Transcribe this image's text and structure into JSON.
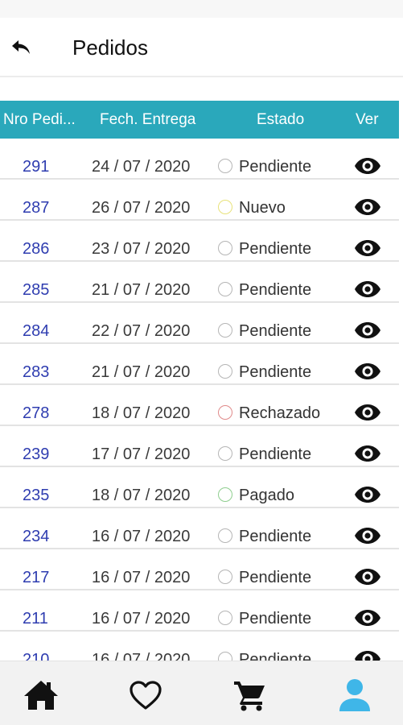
{
  "header": {
    "title": "Pedidos"
  },
  "table": {
    "columns": {
      "nro": "Nro Pedi...",
      "fecha": "Fech. Entrega",
      "estado": "Estado",
      "ver": "Ver"
    },
    "rows": [
      {
        "nro": "291",
        "fecha": "24 / 07 / 2020",
        "estado": "Pendiente",
        "status_color": "#b5b5b5"
      },
      {
        "nro": "287",
        "fecha": "26 / 07 / 2020",
        "estado": "Nuevo",
        "status_color": "#e8e27a"
      },
      {
        "nro": "286",
        "fecha": "23 / 07 / 2020",
        "estado": "Pendiente",
        "status_color": "#b5b5b5"
      },
      {
        "nro": "285",
        "fecha": "21 / 07 / 2020",
        "estado": "Pendiente",
        "status_color": "#b5b5b5"
      },
      {
        "nro": "284",
        "fecha": "22 / 07 / 2020",
        "estado": "Pendiente",
        "status_color": "#b5b5b5"
      },
      {
        "nro": "283",
        "fecha": "21 / 07 / 2020",
        "estado": "Pendiente",
        "status_color": "#b5b5b5"
      },
      {
        "nro": "278",
        "fecha": "18 / 07 / 2020",
        "estado": "Rechazado",
        "status_color": "#e08a8a"
      },
      {
        "nro": "239",
        "fecha": "17 / 07 / 2020",
        "estado": "Pendiente",
        "status_color": "#b5b5b5"
      },
      {
        "nro": "235",
        "fecha": "18 / 07 / 2020",
        "estado": "Pagado",
        "status_color": "#8fce8f"
      },
      {
        "nro": "234",
        "fecha": "16 / 07 / 2020",
        "estado": "Pendiente",
        "status_color": "#b5b5b5"
      },
      {
        "nro": "217",
        "fecha": "16 / 07 / 2020",
        "estado": "Pendiente",
        "status_color": "#b5b5b5"
      },
      {
        "nro": "211",
        "fecha": "16 / 07 / 2020",
        "estado": "Pendiente",
        "status_color": "#b5b5b5"
      },
      {
        "nro": "210",
        "fecha": "16 / 07 / 2020",
        "estado": "Pendiente",
        "status_color": "#b5b5b5"
      }
    ]
  },
  "colors": {
    "header_bg": "#2aa8bb",
    "order_link": "#2f3db0",
    "nav_active": "#3fb6e8"
  },
  "bottom_nav": {
    "items": [
      {
        "icon": "home-icon",
        "active": false
      },
      {
        "icon": "heart-icon",
        "active": false
      },
      {
        "icon": "cart-icon",
        "active": false
      },
      {
        "icon": "user-icon",
        "active": true
      }
    ]
  }
}
